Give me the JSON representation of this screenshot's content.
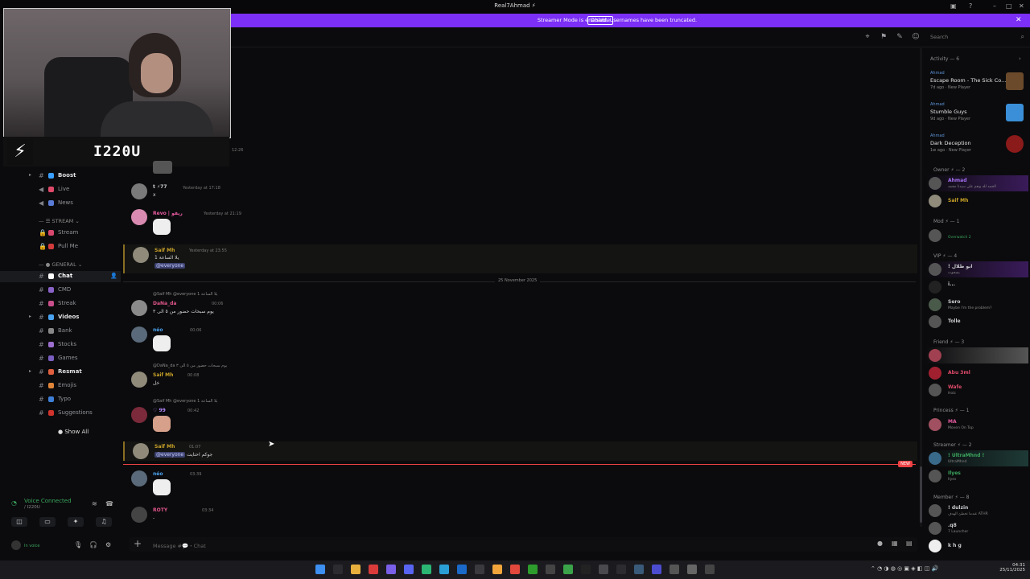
{
  "window": {
    "title": "Real7Ahmad ⚡"
  },
  "banner": {
    "text": "Streamer Mode is enabled. Usernames have been truncated.",
    "button": "Disable"
  },
  "header": {
    "search_placeholder": "Search"
  },
  "webcam": {
    "brand": "I220U"
  },
  "sidebar": {
    "channels": [
      {
        "label": "Boost",
        "color": "#3aa0ff",
        "bold": true
      },
      {
        "label": "Live",
        "color": "#e04a6a"
      },
      {
        "label": "News",
        "color": "#5a7bd6"
      },
      {
        "label": "Stream",
        "color": "#d9486e"
      },
      {
        "label": "Pull Me",
        "color": "#d13b3b"
      },
      {
        "label": "Chat",
        "color": "#ffffff",
        "active": true
      },
      {
        "label": "CMD",
        "color": "#8a63c9"
      },
      {
        "label": "Streak",
        "color": "#c84f8b"
      },
      {
        "label": "Videos",
        "color": "#4aa3f0",
        "bold": true
      },
      {
        "label": "Bank",
        "color": "#888888"
      },
      {
        "label": "Stocks",
        "color": "#9c6fcf"
      },
      {
        "label": "Games",
        "color": "#7a5fc0"
      },
      {
        "label": "Resmat",
        "color": "#e06040",
        "bold": true
      },
      {
        "label": "Emojis",
        "color": "#e0863a"
      },
      {
        "label": "Typo",
        "color": "#3e7fd8"
      },
      {
        "label": "Suggestions",
        "color": "#d0342c"
      }
    ],
    "categories": [
      "STREAM",
      "GENERAL"
    ],
    "show_all": "Show All"
  },
  "voice": {
    "status": "Voice Connected",
    "sub": "/ I220U",
    "user_status": "In voice"
  },
  "chat": {
    "date_divider": "25 November 2025",
    "new_badge": "NEW",
    "composer_placeholder": "Message #💬・Chat",
    "messages": [
      {
        "name": "t ⚡77",
        "color": "#e6e6e6",
        "time": "Yesterday at 17:18",
        "text": "x"
      },
      {
        "name": "Revo | ريفو",
        "color": "#e85aa0",
        "time": "Yesterday at 21:19",
        "text": ""
      },
      {
        "name": "Saif Mh",
        "color": "#c9a227",
        "time": "Yesterday at 23:55",
        "text": "يلا الساعة 1",
        "mention": "@everyone"
      },
      {
        "name": "DaNa_da",
        "color": "#e0558a",
        "time": "00:06",
        "text": "يوم سبحات حضور من ٥ الى ٣",
        "reply": "@Saif Mh @everyone يلا الساعة 1"
      },
      {
        "name": "néo",
        "color": "#4aa3f0",
        "time": "00:06",
        "text": ""
      },
      {
        "name": "Saif Mh",
        "color": "#c9a227",
        "time": "00:08",
        "text": "خل",
        "reply": "@DaNa_da يوم سبحات حضور من ٥ الى ٣"
      },
      {
        "name": "♡ 99",
        "color": "#b085f5",
        "time": "00:42",
        "text": "",
        "reply": "@Saif Mh @everyone يلا الساعة 1"
      },
      {
        "name": "Saif Mh",
        "color": "#c9a227",
        "time": "01:07",
        "text": "جوكم احتايت",
        "mention": "@everyone"
      },
      {
        "name": "néo",
        "color": "#4aa3f0",
        "time": "03:39",
        "text": ""
      },
      {
        "name": "ROTY",
        "color": "#e0558a",
        "time": "03:34",
        "text": "-"
      }
    ],
    "first_time": "12:26"
  },
  "members": {
    "activity_header": "Activity — 6",
    "activities": [
      {
        "user": "Ahmad",
        "game": "Escape Room - The Sick Co...",
        "meta": "7d ago · New Player",
        "color": "#6b4a2b"
      },
      {
        "user": "Ahmad",
        "game": "Stumble Guys",
        "meta": "9d ago · New Player",
        "color": "#3a8fd8"
      },
      {
        "user": "Ahmad",
        "game": "Dark Deception",
        "meta": "1w ago · New Player",
        "color": "#8b1a1a"
      }
    ],
    "groups": [
      {
        "title": "Owner ⚡ — 2",
        "members": [
          {
            "name": "Ahmad",
            "status": "الحمد لله ونعم علي سيدنا محمد",
            "color": "#a46ff0"
          },
          {
            "name": "Saif Mh",
            "status": "",
            "color": "#c9a227"
          }
        ]
      },
      {
        "title": "Mod ⚡ — 1",
        "members": [
          {
            "name": "",
            "status": "Overwatch 2",
            "color": "#3ba55d"
          }
        ]
      },
      {
        "title": "VIP ⚡ — 4",
        "members": [
          {
            "name": "! ابو طلال",
            "status": "بسجوت",
            "color": "#e6e6e6"
          },
          {
            "name": "i...",
            "status": "",
            "color": "#e6e6e6"
          },
          {
            "name": "Sero",
            "status": "Maybe I'm the problem?",
            "color": "#e6e6e6"
          },
          {
            "name": "Tolle",
            "status": "",
            "color": "#e6e6e6"
          }
        ]
      },
      {
        "title": "Friend ⚡ — 3",
        "members": [
          {
            "name": "",
            "status": "",
            "color": "#e04a6a"
          },
          {
            "name": "Abu 3ml",
            "status": "",
            "color": "#e04a6a"
          },
          {
            "name": "Wafe",
            "status": "Holz",
            "color": "#e04a6a"
          }
        ]
      },
      {
        "title": "Princess ⚡ — 1",
        "members": [
          {
            "name": "MA",
            "status": "Moven On Top",
            "color": "#e85aa0"
          }
        ]
      },
      {
        "title": "Streamer ⚡ — 2",
        "members": [
          {
            "name": "! UltraMhnd !",
            "status": "UltraMhnd",
            "color": "#3ba55d"
          },
          {
            "name": "Ilyes",
            "status": "Ilyes",
            "color": "#3ba55d"
          }
        ]
      },
      {
        "title": "Member ⚡ — 8",
        "members": [
          {
            "name": "! dulzin",
            "status": "عندما تخطئ الهدف ATHR",
            "color": "#e6e6e6"
          },
          {
            "name": ".q8",
            "status": "7 Launcher",
            "color": "#e6e6e6"
          },
          {
            "name": "k h g",
            "status": "",
            "color": "#e6e6e6"
          }
        ]
      }
    ]
  },
  "taskbar": {
    "time": "04:31",
    "date": "25/11/2025"
  }
}
